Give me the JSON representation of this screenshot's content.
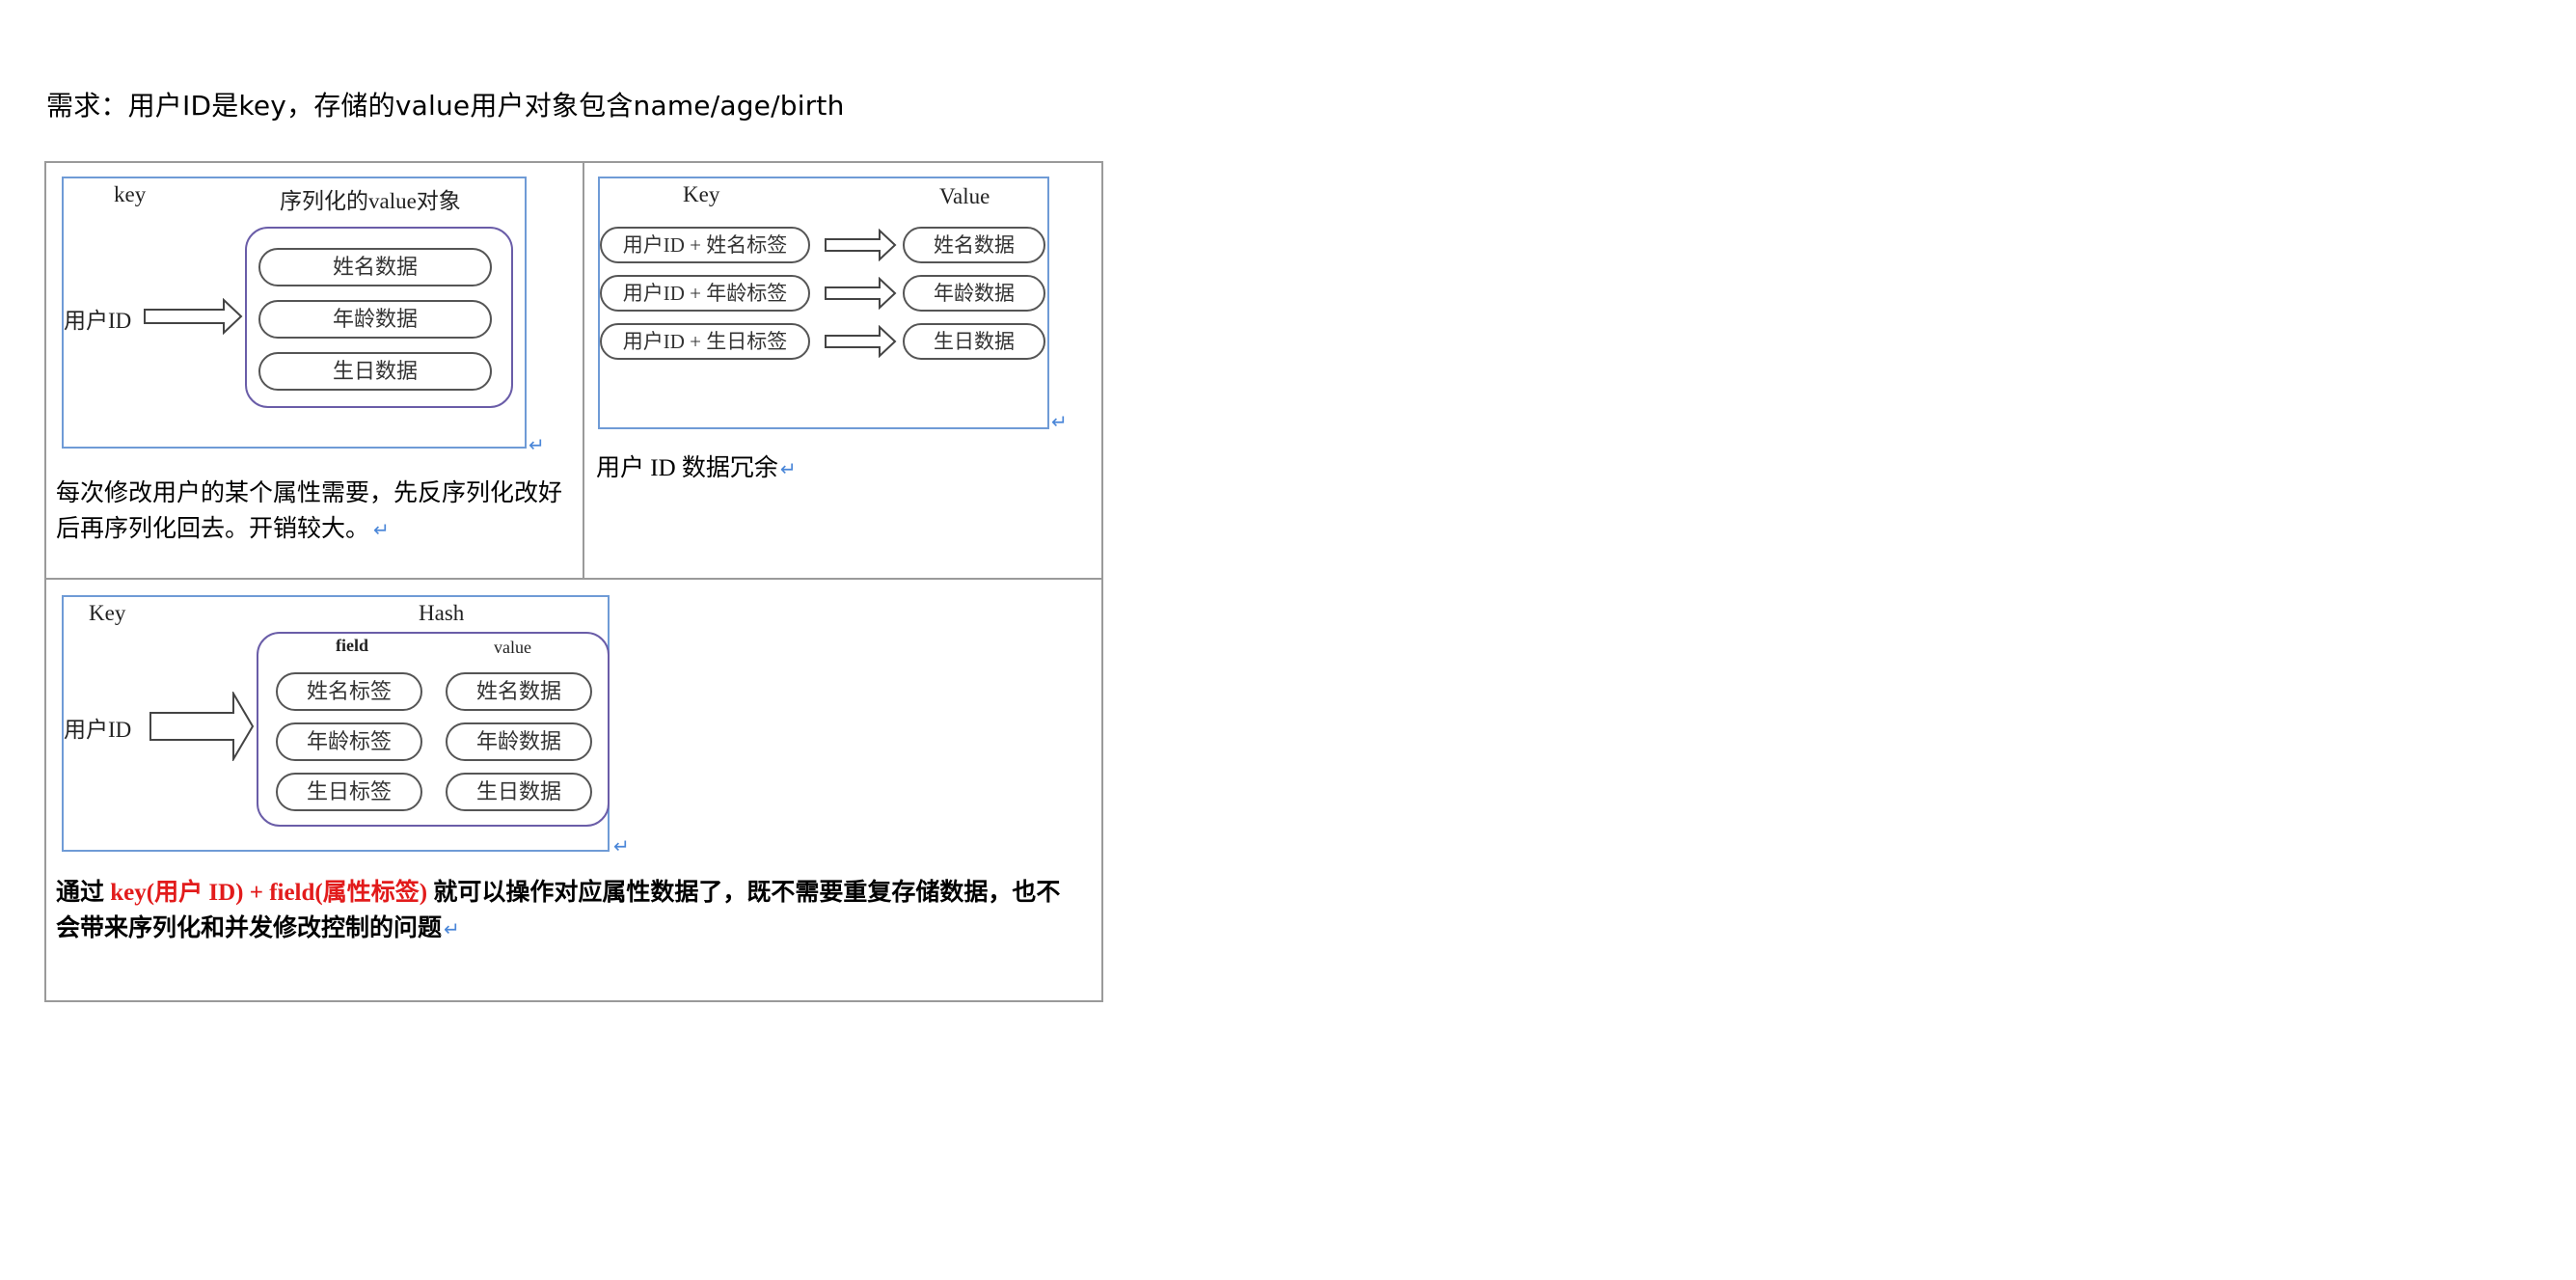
{
  "heading": "需求：用户ID是key，存储的value用户对象包含name/age/birth",
  "return_mark": "↵",
  "cell1": {
    "fig": {
      "key_label": "key",
      "value_label": "序列化的value对象",
      "left_label": "用户ID",
      "pills": [
        "姓名数据",
        "年龄数据",
        "生日数据"
      ]
    },
    "caption_line1": "每次修改用户的某个属性需要，先反序列化改好",
    "caption_line2": "后再序列化回去。开销较大。"
  },
  "cell2": {
    "fig": {
      "key_label": "Key",
      "value_label": "Value",
      "rows": [
        {
          "key": "用户ID + 姓名标签",
          "value": "姓名数据"
        },
        {
          "key": "用户ID + 年龄标签",
          "value": "年龄数据"
        },
        {
          "key": "用户ID + 生日标签",
          "value": "生日数据"
        }
      ]
    },
    "caption": "用户 ID 数据冗余"
  },
  "cell3": {
    "fig": {
      "key_label": "Key",
      "hash_label": "Hash",
      "field_label": "field",
      "value_label": "value",
      "left_label": "用户ID",
      "fields": [
        "姓名标签",
        "年龄标签",
        "生日标签"
      ],
      "values": [
        "姓名数据",
        "年龄数据",
        "生日数据"
      ]
    },
    "caption_prefix": "通过 ",
    "caption_highlight": "key(用户 ID) + field(属性标签)",
    "caption_rest": " 就可以操作对应属性数据了，既不需要重复存储数据，也不",
    "caption_line2": "会带来序列化和并发修改控制的问题"
  }
}
